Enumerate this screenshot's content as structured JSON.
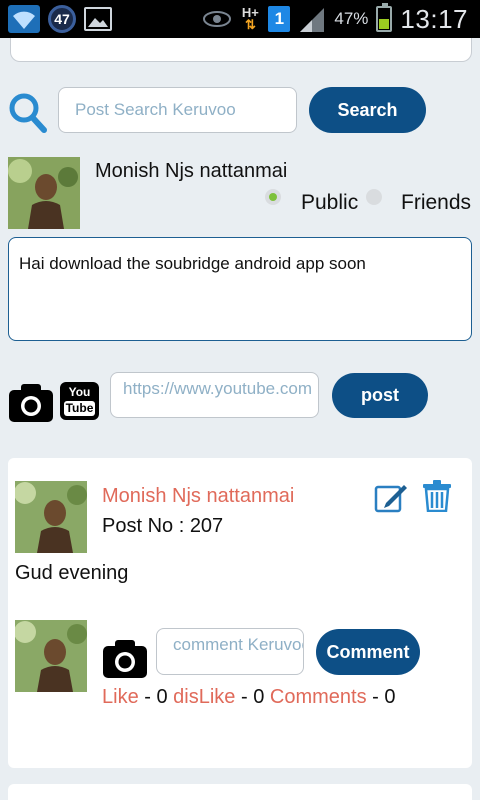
{
  "status_bar": {
    "notification_count": "47",
    "network": "H+",
    "sim": "1",
    "battery_percent": "47%",
    "battery_level": 0.47,
    "time": "13:17",
    "icons": [
      "wifi-icon",
      "notification-badge",
      "gallery-icon",
      "eye-icon",
      "network-hplus-icon",
      "sim-icon",
      "signal-icon",
      "battery-icon"
    ]
  },
  "search": {
    "placeholder": "Post Search Keruvoo",
    "button_label": "Search",
    "icon": "search-icon"
  },
  "composer": {
    "user_name": "Monish Njs nattanmai",
    "visibility_options": [
      {
        "label": "Public",
        "selected": true
      },
      {
        "label": "Friends",
        "selected": false
      }
    ],
    "text": "Hai download the soubridge android app soon",
    "youtube_placeholder": "https://www.youtube.com",
    "post_button_label": "post"
  },
  "feed": {
    "post": {
      "author": "Monish Njs nattanmai",
      "post_no_label": "Post No : 207",
      "text": "Gud evening",
      "comment_placeholder": "comment Keruvoo",
      "comment_button_label": "Comment",
      "like_label": "Like",
      "like_count": "- 0",
      "dislike_label": "disLike",
      "dislike_count": "- 0",
      "comments_label": "Comments",
      "comments_count": "- 0"
    }
  },
  "colors": {
    "primary_button": "#0d4f86",
    "accent_link": "#e06a5a",
    "search_icon": "#2a8bd0",
    "radio_selected": "#7dc13a"
  }
}
